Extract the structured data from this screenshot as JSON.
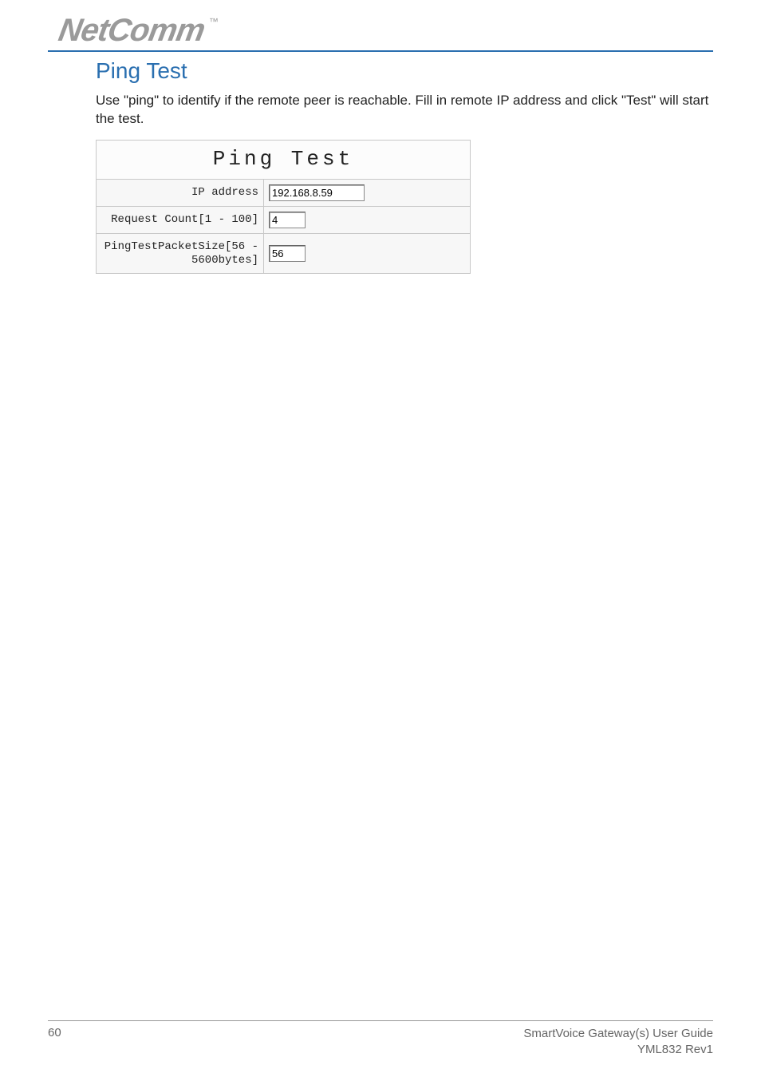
{
  "logo": {
    "brand": "NetComm",
    "tm": "™"
  },
  "section": {
    "title": "Ping Test"
  },
  "body": {
    "paragraph": "Use \"ping\" to identify if the remote peer is reachable. Fill in remote IP address and click \"Test\" will start the test."
  },
  "ui": {
    "title": "Ping Test",
    "rows": [
      {
        "label": "IP address",
        "value": "192.168.8.59",
        "cls": "ip-input"
      },
      {
        "label": "Request Count[1 - 100]",
        "value": "4",
        "cls": "small-input"
      },
      {
        "label": "PingTestPacketSize[56 - 5600bytes]",
        "value": "56",
        "cls": "small-input"
      }
    ]
  },
  "footer": {
    "page_number": "60",
    "guide_title": "SmartVoice Gateway(s) User Guide",
    "doc_rev": "YML832 Rev1"
  }
}
